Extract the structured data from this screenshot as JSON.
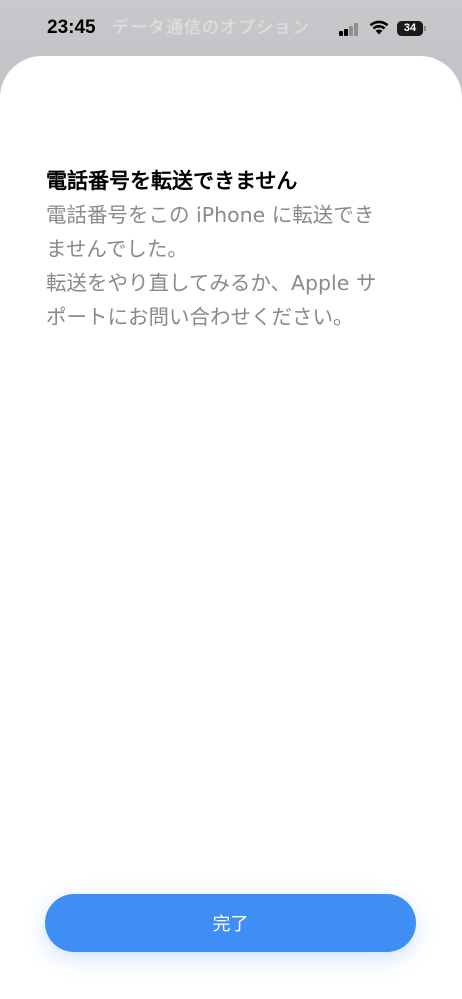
{
  "status_bar": {
    "time": "23:45",
    "battery_level": "34",
    "signal_bars_active": 2,
    "signal_bars_total": 4
  },
  "background_sheet": {
    "title_fragment": "データ通信のオプション",
    "subtitle_fragment": ""
  },
  "dialog": {
    "title": "電話番号を転送できません",
    "message_paragraphs": [
      "電話番号をこの iPhone に転送できませんでした。",
      "転送をやり直してみるか、Apple サポートにお問い合わせください。"
    ],
    "done_label": "完了"
  },
  "colors": {
    "accent": "#3f8ef3",
    "secondary_text": "#8a8a8e",
    "sheet_background": "#ffffff"
  },
  "icons": [
    "signal-icon",
    "wifi-icon",
    "battery-icon"
  ]
}
